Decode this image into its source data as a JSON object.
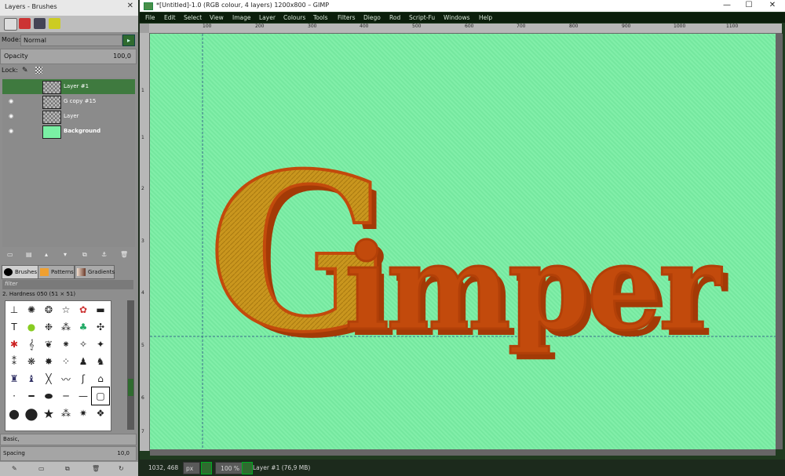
{
  "dock": {
    "title": "Layers - Brushes",
    "mode_label": "Mode:",
    "mode_value": "Normal",
    "opacity_label": "Opacity",
    "opacity_value": "100,0",
    "lock_label": "Lock:",
    "layers": [
      {
        "name": "Layer #1",
        "visible": false,
        "selected": true,
        "bold": false
      },
      {
        "name": "G copy #15",
        "visible": true,
        "selected": false,
        "bold": false
      },
      {
        "name": "Layer",
        "visible": true,
        "selected": false,
        "bold": false
      },
      {
        "name": "Background",
        "visible": true,
        "selected": false,
        "bold": true
      }
    ],
    "tabs": [
      "Brushes",
      "Patterns",
      "Gradients"
    ],
    "filter_placeholder": "filter",
    "brush_name": "2. Hardness 050 (51 × 51)",
    "brush_preset": "Basic,",
    "spacing_label": "Spacing",
    "spacing_value": "10,0"
  },
  "window": {
    "title": "*[Untitled]-1.0 (RGB colour, 4 layers) 1200x800 – GIMP",
    "menu": [
      "File",
      "Edit",
      "Select",
      "View",
      "Image",
      "Layer",
      "Colours",
      "Tools",
      "Filters",
      "Diego",
      "Rod",
      "Script-Fu",
      "Windows",
      "Help"
    ],
    "ruler_labels": [
      "100",
      "200",
      "300",
      "400",
      "500",
      "600",
      "700",
      "800",
      "900",
      "1000",
      "1100"
    ],
    "left_ruler_labels": [
      "1",
      "1",
      "2",
      "3",
      "4",
      "5",
      "6",
      "7"
    ]
  },
  "canvas": {
    "text": "Gimper",
    "background_color": "#79eea4",
    "text_fill": "#c9961e",
    "text_outline": "#c24a0c"
  },
  "status": {
    "coords": "1032, 468",
    "unit": "px",
    "zoom": "100 %",
    "info": "Layer #1 (76,9 MB)"
  }
}
